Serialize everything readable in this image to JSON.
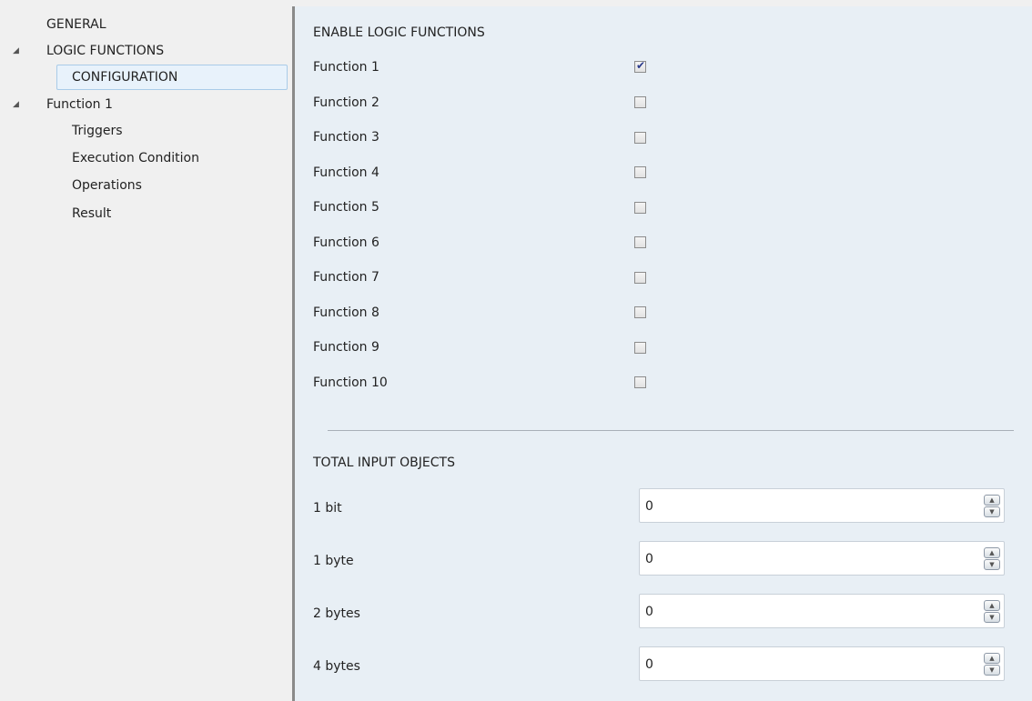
{
  "sidebar": {
    "items": [
      {
        "label": "GENERAL"
      },
      {
        "label": "LOGIC FUNCTIONS",
        "arrow": "expanded-triangle-icon"
      },
      {
        "label": "CONFIGURATION",
        "selected": true
      },
      {
        "label": "Function 1",
        "arrow": "expanded-triangle-icon"
      },
      {
        "label": "Triggers"
      },
      {
        "label": "Execution Condition"
      },
      {
        "label": "Operations"
      },
      {
        "label": "Result"
      }
    ]
  },
  "main": {
    "enable_section": {
      "title": "ENABLE LOGIC FUNCTIONS",
      "functions": [
        {
          "label": "Function 1",
          "checked": true
        },
        {
          "label": "Function 2",
          "checked": false
        },
        {
          "label": "Function 3",
          "checked": false
        },
        {
          "label": "Function 4",
          "checked": false
        },
        {
          "label": "Function 5",
          "checked": false
        },
        {
          "label": "Function 6",
          "checked": false
        },
        {
          "label": "Function 7",
          "checked": false
        },
        {
          "label": "Function 8",
          "checked": false
        },
        {
          "label": "Function 9",
          "checked": false
        },
        {
          "label": "Function 10",
          "checked": false
        }
      ]
    },
    "inputs_section": {
      "title": "TOTAL INPUT OBJECTS",
      "rows": [
        {
          "label": "1 bit",
          "value": "0"
        },
        {
          "label": "1 byte",
          "value": "0"
        },
        {
          "label": "2 bytes",
          "value": "0"
        },
        {
          "label": "4 bytes",
          "value": "0"
        }
      ]
    }
  },
  "colors": {
    "sidebar_bg": "#f0f0f0",
    "panel_bg": "#e8eff5",
    "selection_bg": "#e8f2fb",
    "selection_border": "#a9cbe8",
    "check_color": "#2a3a8c"
  }
}
